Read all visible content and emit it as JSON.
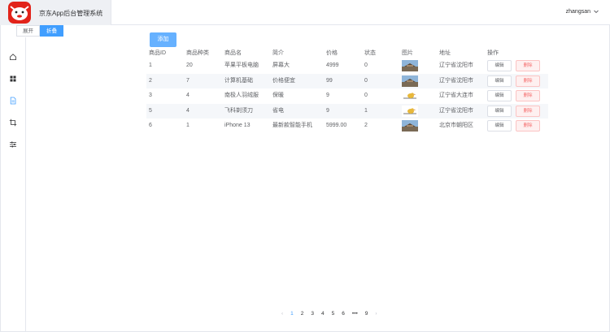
{
  "header": {
    "app_title": "京东App后台管理系统",
    "username": "zhangsan"
  },
  "collapse": {
    "expand_label": "展开",
    "collapse_label": "折叠"
  },
  "toolbar": {
    "add_label": "添加"
  },
  "table": {
    "headers": [
      "商品ID",
      "商品种类",
      "商品名",
      "简介",
      "价格",
      "状态",
      "图片",
      "地址",
      "操作"
    ],
    "rows": [
      {
        "id": "1",
        "category": "20",
        "name": "苹果平板电脑",
        "intro": "屏幕大",
        "price": "4999",
        "status": "0",
        "image": "city-photo",
        "address": "辽宁省沈阳市",
        "edit": "编辑",
        "delete": "删除"
      },
      {
        "id": "2",
        "category": "7",
        "name": "计算机基础",
        "intro": "价格便宜",
        "price": "99",
        "status": "0",
        "image": "city-photo",
        "address": "辽宁省沈阳市",
        "edit": "编辑",
        "delete": "删除"
      },
      {
        "id": "3",
        "category": "4",
        "name": "南极人羽绒服",
        "intro": "保暖",
        "price": "9",
        "status": "0",
        "image": "duck-photo",
        "address": "辽宁省大连市",
        "edit": "编辑",
        "delete": "删除"
      },
      {
        "id": "5",
        "category": "4",
        "name": "飞科剃须刀",
        "intro": "省电",
        "price": "9",
        "status": "1",
        "image": "duck-photo",
        "address": "辽宁省沈阳市",
        "edit": "编辑",
        "delete": "删除"
      },
      {
        "id": "6",
        "category": "1",
        "name": "iPhone 13",
        "intro": "最新款智能手机",
        "price": "5999.00",
        "status": "2",
        "image": "city-photo",
        "address": "北京市朝阳区",
        "edit": "编辑",
        "delete": "删除"
      }
    ]
  },
  "pagination": {
    "pages": [
      "1",
      "2",
      "3",
      "4",
      "5",
      "6",
      "•••",
      "9"
    ],
    "current": "1",
    "prev": "‹",
    "next": "›"
  },
  "sidebar": {
    "icons": [
      "home-icon",
      "grid-icon",
      "document-icon",
      "crop-icon",
      "sliders-icon"
    ],
    "active": "document-icon"
  },
  "colors": {
    "primary": "#409eff",
    "danger": "#f56c6c",
    "brand_bg": "#eef0f4"
  }
}
